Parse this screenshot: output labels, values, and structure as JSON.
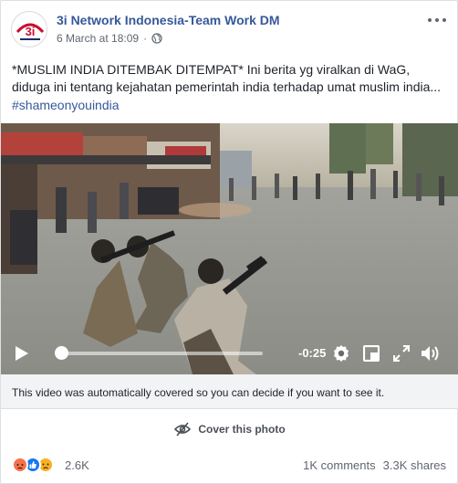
{
  "post": {
    "author": "3i Network Indonesia-Team Work DM",
    "date": "6 March at 18:09",
    "separator": "·",
    "text_line1": "*MUSLIM INDIA DITEMBAK DITEMPAT* Ini berita yg viralkan di WaG,",
    "text_line2": "diduga ini tentang kejahatan pemerintah india terhadap umat muslim india...",
    "hashtag": "#shameonyouindia",
    "avatar_text": "3i"
  },
  "video": {
    "time_remaining": "-0:25",
    "progress": 0.0,
    "icons": [
      "play-icon",
      "gear-icon",
      "miniplayer-icon",
      "expand-icon",
      "volume-icon"
    ]
  },
  "notice": {
    "text": "This video was automatically covered so you can decide if you want to see it."
  },
  "cover": {
    "label": "Cover this photo"
  },
  "footer": {
    "reaction_count": "2.6K",
    "comments": "1K comments",
    "shares": "3.3K shares",
    "reactions": [
      "angry",
      "like",
      "sad"
    ]
  },
  "colors": {
    "link": "#365899",
    "angry": "#f7714b",
    "like": "#1877f2",
    "sad": "#f7b125"
  }
}
